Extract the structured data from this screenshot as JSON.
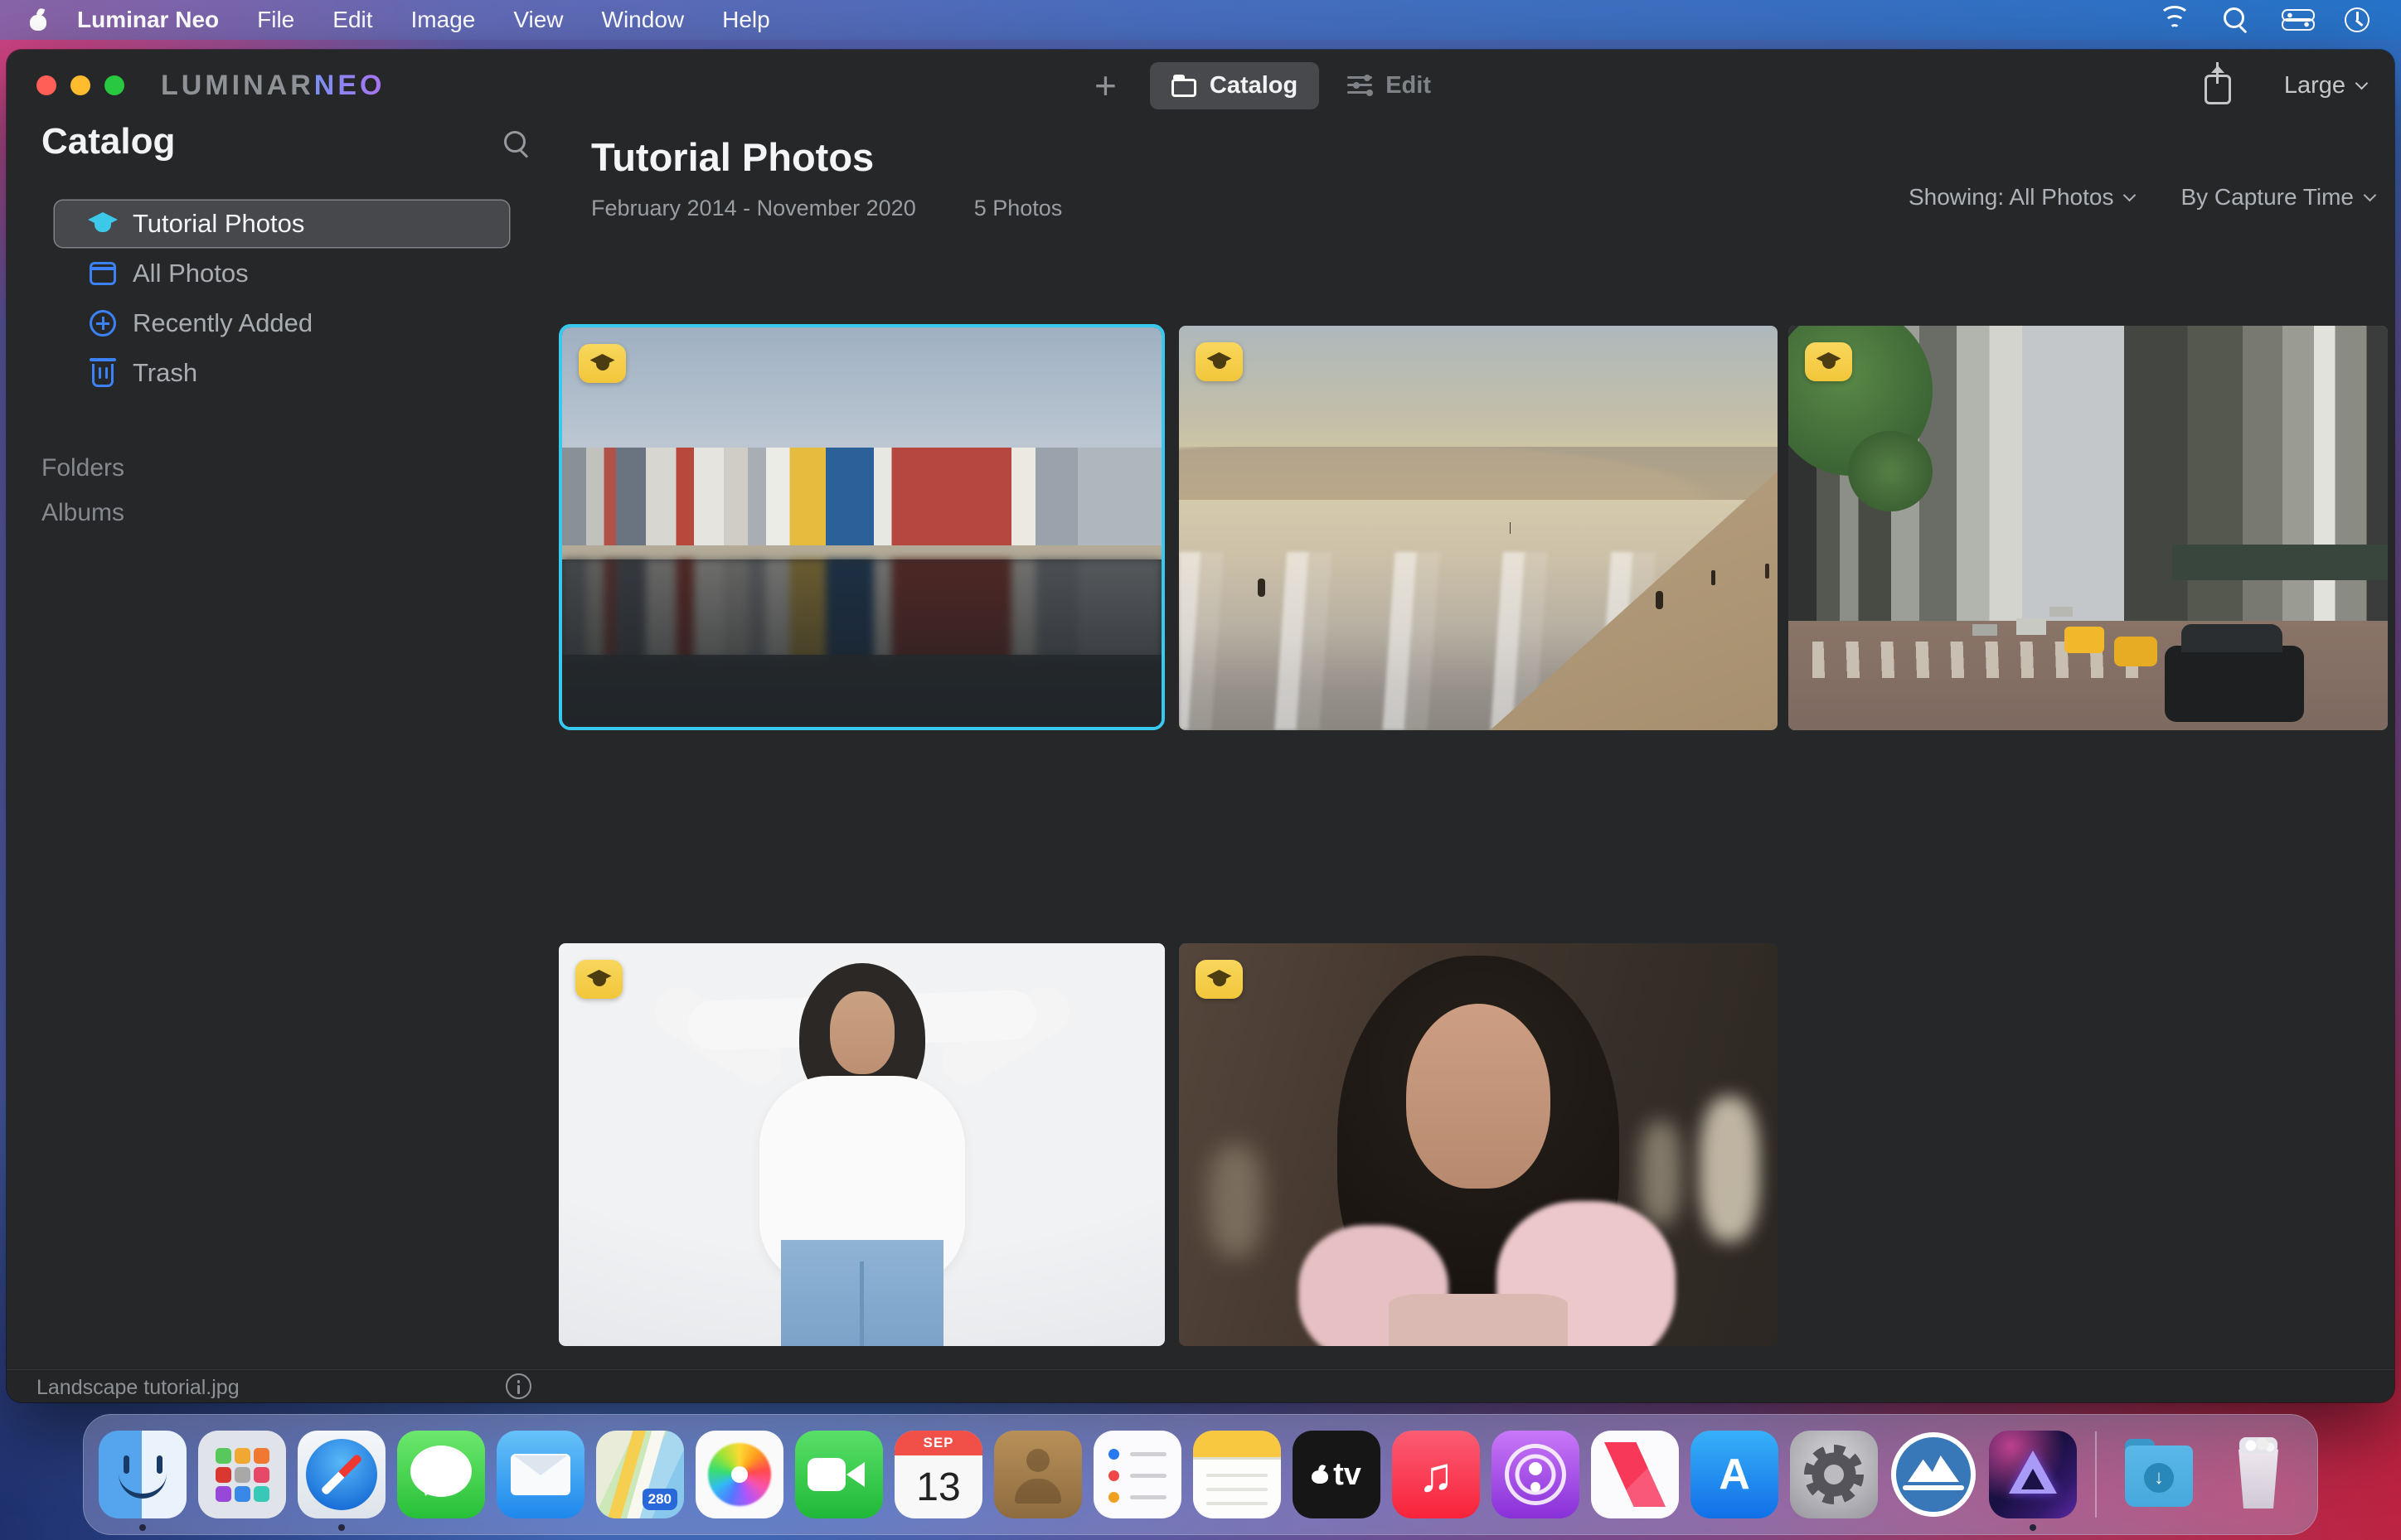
{
  "menu_bar": {
    "app_name": "Luminar Neo",
    "menus": [
      "File",
      "Edit",
      "Image",
      "View",
      "Window",
      "Help"
    ]
  },
  "titlebar": {
    "logo_primary": "LUMINAR",
    "logo_accent": "NEO",
    "add_label": "+",
    "catalog_label": "Catalog",
    "edit_label": "Edit",
    "thumb_size_label": "Large"
  },
  "sidebar": {
    "title": "Catalog",
    "items": [
      {
        "label": "Tutorial Photos",
        "icon": "graduation-cap-icon",
        "selected": true
      },
      {
        "label": "All Photos",
        "icon": "photos-stack-icon",
        "selected": false
      },
      {
        "label": "Recently Added",
        "icon": "plus-circle-icon",
        "selected": false
      },
      {
        "label": "Trash",
        "icon": "trash-icon",
        "selected": false
      }
    ],
    "sections": [
      {
        "label": "Folders"
      },
      {
        "label": "Albums"
      }
    ]
  },
  "content": {
    "title": "Tutorial Photos",
    "date_range": "February 2014 - November 2020",
    "photo_count": "5 Photos",
    "showing_filter": "Showing: All Photos",
    "sort_filter": "By Capture Time",
    "photos": [
      {
        "name": "canal-houses",
        "badge": "tutorial",
        "selected": true
      },
      {
        "name": "beach-sunset",
        "badge": "tutorial",
        "selected": false
      },
      {
        "name": "city-street-taxis",
        "badge": "tutorial",
        "selected": false
      },
      {
        "name": "studio-portrait-white-blouse",
        "badge": "tutorial",
        "selected": false
      },
      {
        "name": "closeup-portrait-pink-ruffle",
        "badge": "tutorial",
        "selected": false
      }
    ]
  },
  "status_bar": {
    "filename": "Landscape tutorial.jpg"
  },
  "dock": {
    "calendar": {
      "month": "SEP",
      "day": "13"
    },
    "maps_badge": "280",
    "appletv_label": "tv",
    "appstore_label": "A",
    "download_arrow": "↓",
    "music_note": "♫",
    "items": [
      "Finder",
      "Launchpad",
      "Safari",
      "Messages",
      "Mail",
      "Maps",
      "Photos",
      "FaceTime",
      "Calendar",
      "Contacts",
      "Reminders",
      "Notes",
      "Apple TV",
      "Music",
      "Podcasts",
      "News",
      "App Store",
      "System Settings",
      "Luminar AI",
      "Luminar Neo",
      "Downloads",
      "Trash"
    ]
  }
}
